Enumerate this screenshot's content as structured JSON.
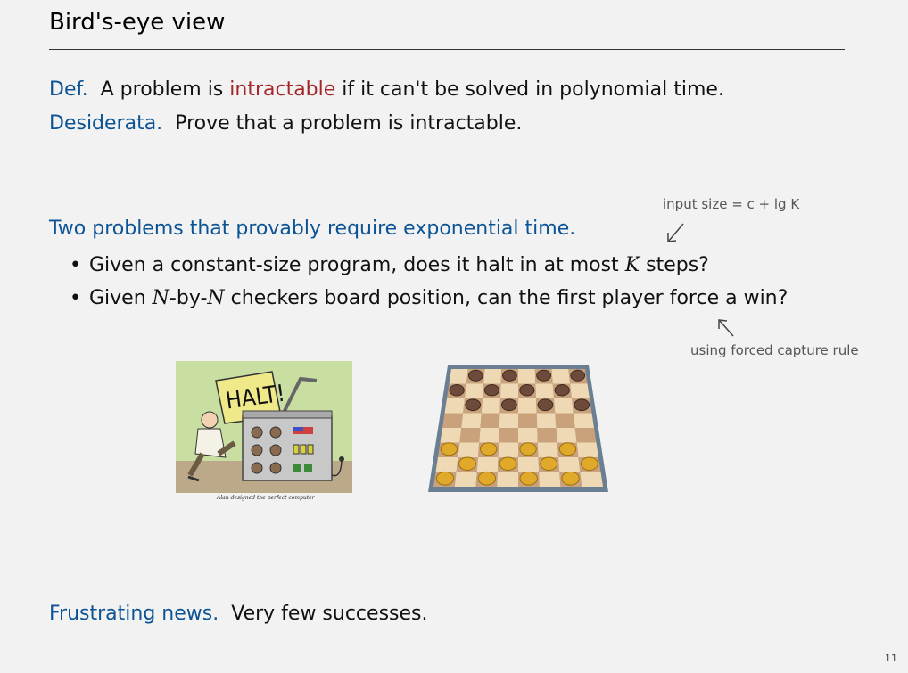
{
  "slide": {
    "title": "Bird's-eye view",
    "def_label": "Def.",
    "def_text_1": "A problem is",
    "def_highlight": "intractable",
    "def_text_2": "if it can't be solved in polynomial time.",
    "desiderata_label": "Desiderata.",
    "desiderata_text": "Prove that a problem is intractable.",
    "two_problems": "Two problems that provably require exponential time.",
    "bullet1_a": "Given a constant-size program, does it halt in at most",
    "bullet1_k": "K",
    "bullet1_b": "steps?",
    "bullet2_a": "Given",
    "bullet2_n1": "N",
    "bullet2_by": "-by-",
    "bullet2_n2": "N",
    "bullet2_b": "checkers board position, can the first player force a win?",
    "note_top": "input size = c + lg K",
    "note_bottom": "using forced capture rule",
    "halt_sign": "HALT!",
    "cartoon_caption": "Alan designed the perfect computer",
    "frustrating_label": "Frustrating news.",
    "frustrating_text": "Very few successes.",
    "page_number": "11"
  },
  "colors": {
    "accent_blue": "#0b5394",
    "highlight_red": "#a3262a"
  },
  "icons": [
    "arrow-down-left-icon",
    "arrow-up-left-icon",
    "halt-cartoon",
    "checkers-board"
  ]
}
